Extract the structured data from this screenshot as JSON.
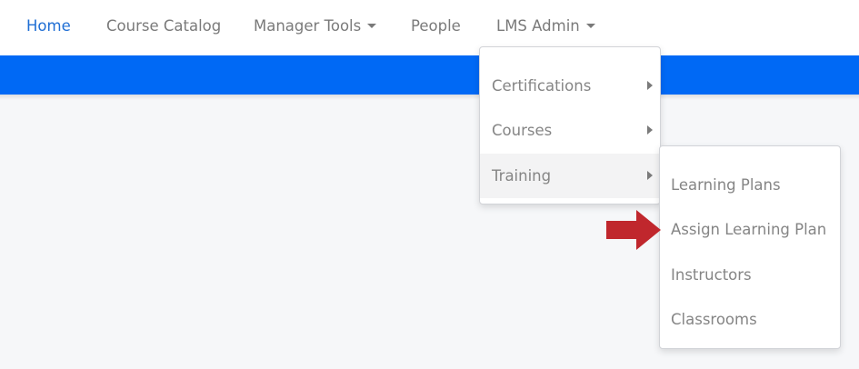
{
  "nav": {
    "items": [
      {
        "label": "Home",
        "active": true
      },
      {
        "label": "Course Catalog"
      },
      {
        "label": "Manager Tools",
        "has_caret": true
      },
      {
        "label": "People"
      },
      {
        "label": "LMS Admin",
        "has_caret": true
      }
    ]
  },
  "lms_admin_menu": {
    "items": [
      {
        "label": "Certifications",
        "has_submenu": true
      },
      {
        "label": "Courses",
        "has_submenu": true
      },
      {
        "label": "Training",
        "has_submenu": true,
        "highlighted": true
      }
    ]
  },
  "training_submenu": {
    "items": [
      {
        "label": "Learning Plans"
      },
      {
        "label": "Assign Learning Plan",
        "pointed_at": true
      },
      {
        "label": "Instructors"
      },
      {
        "label": "Classrooms"
      }
    ]
  },
  "colors": {
    "accent_blue": "#0069f5",
    "active_link": "#1f6ed4",
    "annotation_arrow": "#c0272d"
  },
  "icons": [
    "caret-down-icon",
    "caret-right-icon",
    "red-arrow-annotation-icon"
  ]
}
